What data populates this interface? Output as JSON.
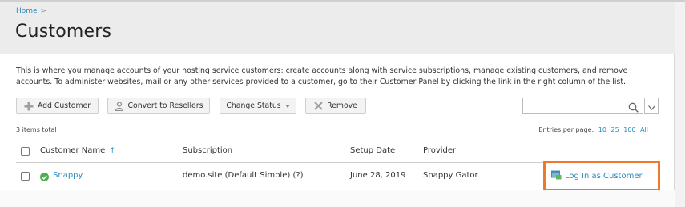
{
  "breadcrumb": {
    "home": "Home",
    "separator": ">"
  },
  "page": {
    "title": "Customers",
    "description": "This is where you manage accounts of your hosting service customers: create accounts along with service subscriptions, manage existing customers, and remove accounts. To administer websites, mail or any other services provided to a customer, go to their Customer Panel by clicking the link in the right column of the list."
  },
  "toolbar": {
    "add_customer": "Add Customer",
    "convert_to_resellers": "Convert to Resellers",
    "change_status": "Change Status",
    "remove": "Remove"
  },
  "search": {
    "placeholder": "",
    "value": ""
  },
  "list": {
    "items_total": "3 items total",
    "entries_per_page_label": "Entries per page:",
    "entries_options": [
      "10",
      "25",
      "100",
      "All"
    ],
    "columns": {
      "customer_name": "Customer Name",
      "sort_indicator": "↑",
      "subscription": "Subscription",
      "setup_date": "Setup Date",
      "provider": "Provider"
    },
    "rows": [
      {
        "customer_name": "Snappy",
        "subscription": "demo.site (Default Simple) (?)",
        "setup_date": "June 28, 2019",
        "provider": "Snappy Gator",
        "action": "Log In as Customer",
        "status": "active"
      }
    ]
  },
  "colors": {
    "link": "#2a8cbf",
    "highlight": "#f07828",
    "status_ok": "#4caf50"
  },
  "icons": {
    "add_customer": "add-user-icon",
    "convert": "reseller-icon",
    "change_status": "dropdown-caret-icon",
    "remove": "remove-icon",
    "search": "search-icon",
    "search_dropdown": "chevron-down-icon",
    "status": "check-circle-icon",
    "login": "customer-panel-icon"
  }
}
